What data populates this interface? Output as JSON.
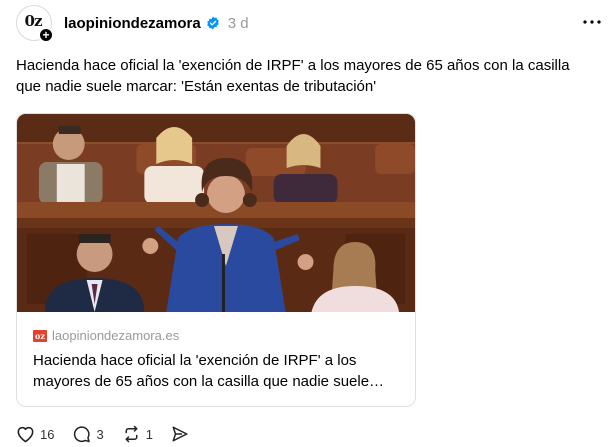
{
  "author": {
    "avatar_text": "0z",
    "username": "laopiniondezamora",
    "timestamp": "3 d",
    "verified": true
  },
  "post": {
    "text": "Hacienda hace oficial la 'exención de IRPF' a los mayores de 65 años con la casilla que nadie suele marcar: 'Están exentas de tributación'"
  },
  "link_card": {
    "favicon_text": "oz",
    "domain": "laopiniondezamora.es",
    "title": "Hacienda hace oficial la 'exención de IRPF' a los mayores de 65 años con la casilla que nadie suele…"
  },
  "actions": {
    "likes": "16",
    "comments": "3",
    "reposts": "1"
  },
  "colors": {
    "verified": "#0095f6",
    "muted_text": "#999999",
    "favicon": "#e2432a"
  }
}
